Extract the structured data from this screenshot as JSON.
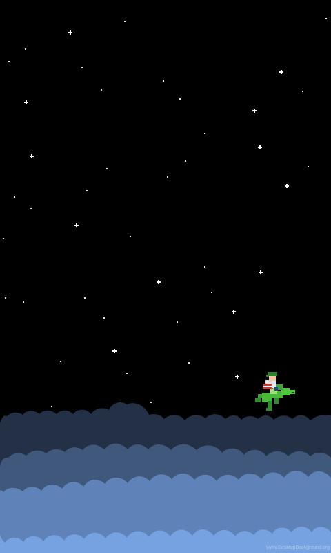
{
  "scene": {
    "type": "pixel-art night sky with clouds",
    "colors": {
      "sky": "#000000",
      "star": "#ffffff",
      "star_glow": "#b9c7ff",
      "cloud_back": "#243045",
      "cloud_mid": "#3f587b",
      "cloud_front": "#5f82b8",
      "cloud_bottom": "#76a2e2"
    },
    "character": {
      "icon": "green-dragon-with-rider-icon",
      "dragon_color": "#49b93a",
      "rider_hat_color": "#2f7f2b",
      "rider_shirt_color": "#dfe7f2",
      "rider_pants_color": "#c93a2e"
    }
  },
  "watermark": "www.DesktopBackground.org"
}
